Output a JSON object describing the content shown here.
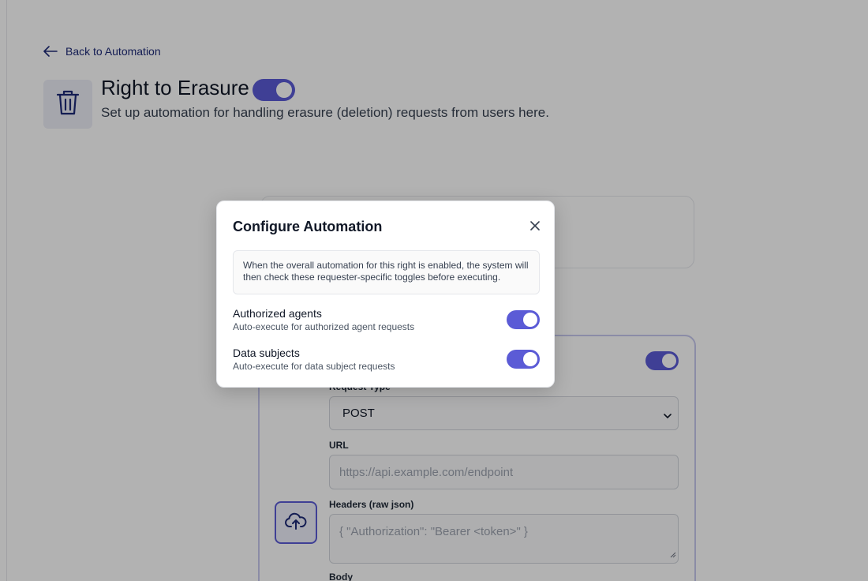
{
  "nav": {
    "back_label": "Back to Automation"
  },
  "header": {
    "title": "Right to Erasure",
    "subtitle": "Set up automation for handling erasure (deletion) requests from users here.",
    "enabled": true
  },
  "webhook": {
    "enabled": true,
    "request_type_label": "Request Type",
    "request_type_value": "POST",
    "url_label": "URL",
    "url_placeholder": "https://api.example.com/endpoint",
    "headers_label": "Headers (raw json)",
    "headers_placeholder": "{ \"Authorization\": \"Bearer <token>\" }",
    "body_label": "Body"
  },
  "modal": {
    "title": "Configure Automation",
    "info": "When the overall automation for this right is enabled, the system will then check these requester-specific toggles before executing.",
    "options": [
      {
        "title": "Authorized agents",
        "description": "Auto-execute for authorized agent requests",
        "enabled": true
      },
      {
        "title": "Data subjects",
        "description": "Auto-execute for data subject requests",
        "enabled": true
      }
    ]
  },
  "colors": {
    "accent": "#5b5bd6",
    "link": "#1e2a78",
    "overlay": "rgba(0,0,0,0.30)"
  },
  "icons": [
    "arrow-left-icon",
    "trash-icon",
    "cloud-upload-icon",
    "chevron-down-icon",
    "close-icon"
  ]
}
